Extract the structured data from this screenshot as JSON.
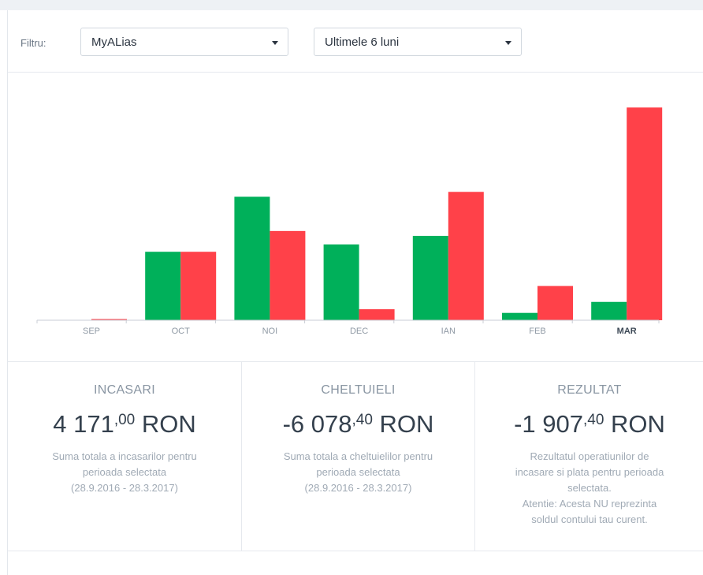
{
  "filter": {
    "label": "Filtru:",
    "account_select": "MyALias",
    "period_select": "Ultimele 6 luni"
  },
  "chart_data": {
    "type": "bar",
    "categories": [
      "SEP",
      "OCT",
      "NOI",
      "DEC",
      "IAN",
      "FEB",
      "MAR"
    ],
    "highlight_category": "MAR",
    "colors": [
      "#00b05a",
      "#ff4149"
    ],
    "series": [
      {
        "values": [
          0,
          560,
          1010,
          620,
          690,
          60,
          150
        ]
      },
      {
        "values": [
          8,
          560,
          730,
          90,
          1050,
          280,
          1740
        ]
      }
    ],
    "ylim": [
      0,
      1800
    ],
    "grid": false
  },
  "stats": [
    {
      "title": "INCASARI",
      "value_int": "4 171",
      "value_dec": ",00",
      "currency": "RON",
      "desc": [
        "Suma totala a incasarilor pentru",
        "perioada selectata",
        "(28.9.2016 - 28.3.2017)"
      ]
    },
    {
      "title": "CHELTUIELI",
      "value_int": "-6 078",
      "value_dec": ",40",
      "currency": "RON",
      "desc": [
        "Suma totala a cheltuielilor pentru",
        "perioada selectata",
        "(28.9.2016 - 28.3.2017)"
      ]
    },
    {
      "title": "REZULTAT",
      "value_int": "-1 907",
      "value_dec": ",40",
      "currency": "RON",
      "desc": [
        "Rezultatul operatiunilor de",
        "incasare si plata pentru perioada",
        "selectata.",
        "Atentie: Acesta NU reprezinta",
        "soldul contului tau curent."
      ]
    }
  ]
}
